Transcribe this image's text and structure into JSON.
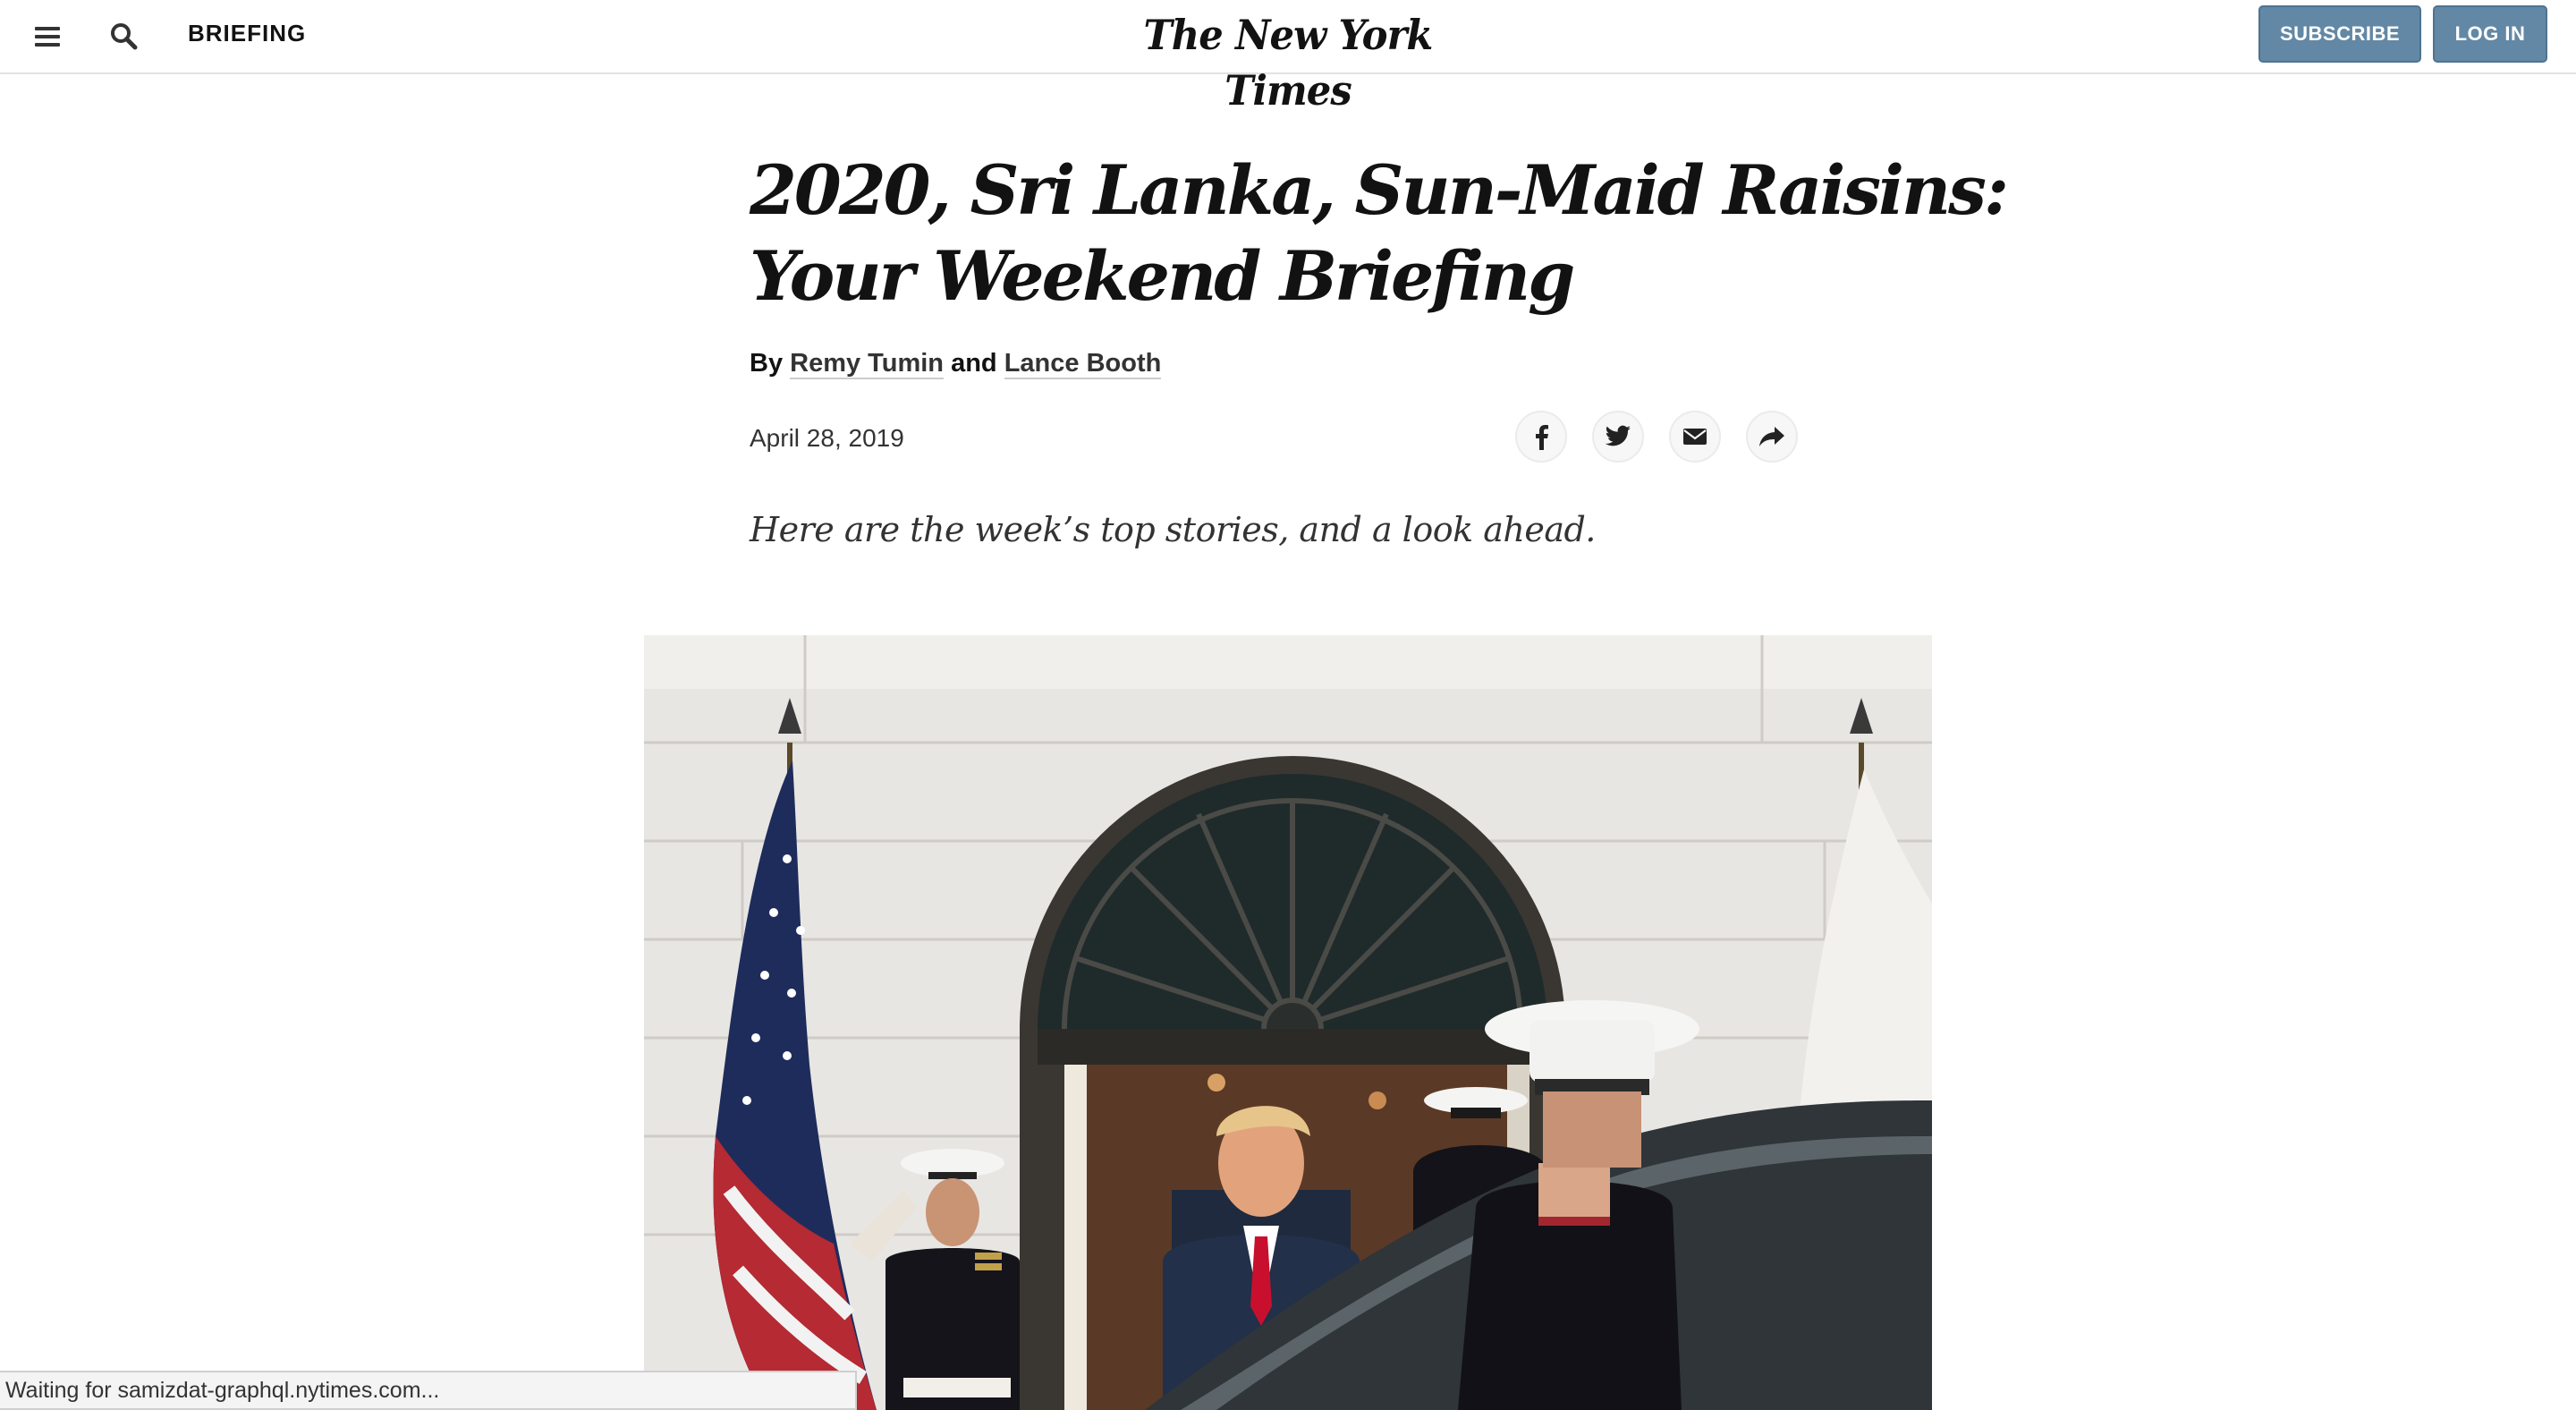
{
  "header": {
    "section_label": "BRIEFING",
    "masthead": "The New York Times",
    "subscribe_label": "SUBSCRIBE",
    "login_label": "LOG IN",
    "icons": {
      "menu": "hamburger-icon",
      "search": "search-icon"
    }
  },
  "article": {
    "headline_line1": "2020, Sri Lanka, Sun-Maid Raisins:",
    "headline_line2": "Your Weekend Briefing",
    "byline": {
      "prefix": "By",
      "author1": "Remy Tumin",
      "conjunction": "and",
      "author2": "Lance Booth"
    },
    "date": "April 28, 2019",
    "summary": "Here are the week’s top stories, and a look ahead.",
    "share_icons": [
      "facebook-icon",
      "twitter-icon",
      "email-icon",
      "share-icon"
    ]
  },
  "status_bar": {
    "text": "Waiting for samizdat-graphql.nytimes.com..."
  },
  "colors": {
    "header_button": "#6288a5",
    "text": "#121212",
    "rule": "#e2e2e2"
  }
}
